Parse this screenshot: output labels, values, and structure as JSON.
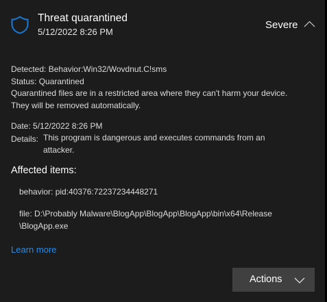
{
  "header": {
    "icon": "shield-icon",
    "title": "Threat quarantined",
    "timestamp": "5/12/2022 8:26 PM",
    "severity": "Severe",
    "toggle_icon": "chevron-up-icon"
  },
  "summary": {
    "detected_label": "Detected:",
    "detected_value": "Behavior:Win32/Wovdnut.C!sms",
    "status_label": "Status:",
    "status_value": "Quarantined",
    "note_line1": "Quarantined files are in a restricted area where they can't harm your device.",
    "note_line2": "They will be removed automatically."
  },
  "details": {
    "date_label": "Date:",
    "date_value": "5/12/2022 8:26 PM",
    "details_label": "Details:",
    "details_line1": "This program is dangerous and executes commands from an",
    "details_line2": "attacker."
  },
  "affected": {
    "heading": "Affected items:",
    "items": [
      {
        "line1": "behavior: pid:40376:72237234448271"
      },
      {
        "line1": "file: D:\\Probably Malware\\BlogApp\\BlogApp\\BlogApp\\bin\\x64\\Release",
        "line2": "\\BlogApp.exe"
      }
    ]
  },
  "learn_more": "Learn more",
  "actions": {
    "label": "Actions",
    "icon": "chevron-down-icon"
  },
  "colors": {
    "accent": "#2b8ae0",
    "shield": "#1a73c8",
    "background": "#1c1c1c",
    "button": "#404040"
  }
}
